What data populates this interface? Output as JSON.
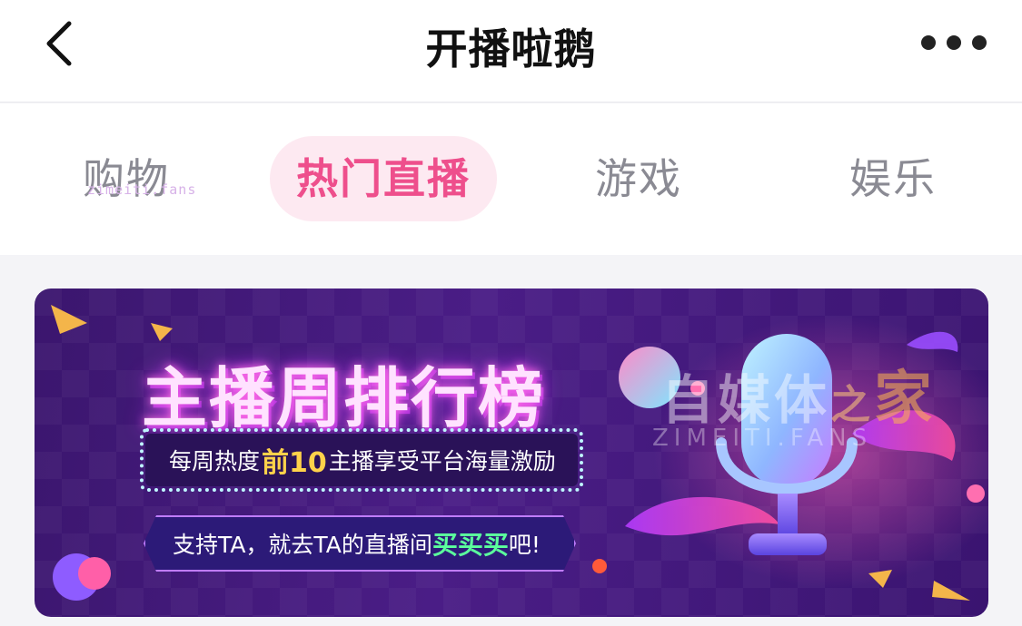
{
  "nav": {
    "title": "开播啦鹅",
    "back_icon": "chevron-left-icon",
    "more_icon": "more-dots-icon"
  },
  "tabs": [
    {
      "label": "购物",
      "active": false
    },
    {
      "label": "热门直播",
      "active": true
    },
    {
      "label": "游戏",
      "active": false
    },
    {
      "label": "娱乐",
      "active": false
    }
  ],
  "tab_watermark": "zimeiti.fans",
  "banner": {
    "title": "主播周排行榜",
    "line1_pre": "每周热度",
    "line1_highlight": "前10",
    "line1_post": "主播享受平台海量激励",
    "line2_pre": "支持TA，就去TA的直播间",
    "line2_highlight": "买买买",
    "line2_post": "吧!",
    "watermark_main": "自媒体",
    "watermark_zhi": "之",
    "watermark_jia": "家",
    "watermark_sub": "ZIMEITI.FANS"
  },
  "colors": {
    "accent": "#ee4f8c",
    "active_tab_bg": "#fde9f1",
    "inactive_tab": "#8a8a93",
    "banner_bg": "#3b166e"
  }
}
